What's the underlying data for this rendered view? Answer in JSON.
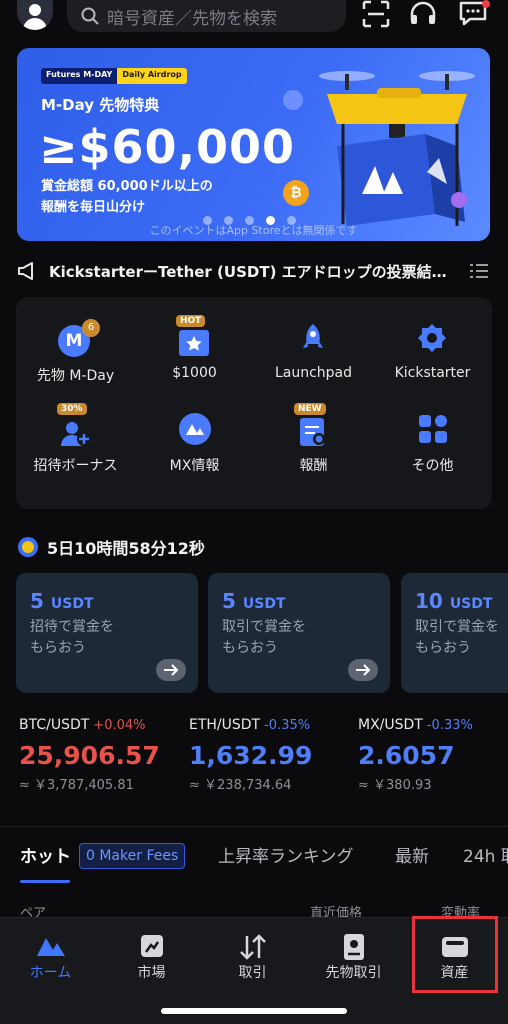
{
  "search": {
    "placeholder": "暗号資産／先物を検索"
  },
  "banner": {
    "tag_left": "Futures M-DAY",
    "tag_right": "Daily Airdrop",
    "subtitle": "M-Day 先物特典",
    "amount": "≥$60,000",
    "desc_line1": "賞金総額 60,000ドル以上の",
    "desc_line2": "報酬を毎日山分け",
    "disclaimer": "このイベントはApp Storeとは無関係です",
    "active_dot": 4,
    "dot_count": 5
  },
  "announcement": {
    "text": "KickstarterーTether (USDT) エアドロップの投票結…"
  },
  "shortcuts": [
    {
      "label": "先物 M-Day",
      "icon": "m-day-icon",
      "badge": "6"
    },
    {
      "label": "$1000",
      "icon": "ticket-icon",
      "badge": "HOT"
    },
    {
      "label": "Launchpad",
      "icon": "rocket-icon",
      "badge": ""
    },
    {
      "label": "Kickstarter",
      "icon": "gear-badge-icon",
      "badge": ""
    },
    {
      "label": "招待ボーナス",
      "icon": "invite-user-icon",
      "badge": "30%"
    },
    {
      "label": "MX情報",
      "icon": "mx-logo-icon",
      "badge": ""
    },
    {
      "label": "報酬",
      "icon": "reward-icon",
      "badge": "NEW"
    },
    {
      "label": "その他",
      "icon": "grid-icon",
      "badge": ""
    }
  ],
  "countdown": {
    "text": "5日10時間58分12秒"
  },
  "rewards": [
    {
      "amount": "5",
      "unit": "USDT",
      "line1": "招待で賞金を",
      "line2": "もらおう"
    },
    {
      "amount": "5",
      "unit": "USDT",
      "line1": "取引で賞金を",
      "line2": "もらおう"
    },
    {
      "amount": "10",
      "unit": "USDT",
      "line1": "取引で賞金を",
      "line2": "もらおう"
    }
  ],
  "tickers": [
    {
      "pair": "BTC/USDT",
      "change": "+0.04%",
      "price": "25,906.57",
      "fiat": "≈ ￥3,787,405.81",
      "color": "#e5534b"
    },
    {
      "pair": "ETH/USDT",
      "change": "-0.35%",
      "price": "1,632.99",
      "fiat": "≈ ￥238,734.64",
      "color": "#4f7ef7"
    },
    {
      "pair": "MX/USDT",
      "change": "-0.33%",
      "price": "2.6057",
      "fiat": "≈ ￥380.93",
      "color": "#4f7ef7"
    }
  ],
  "tabs": {
    "hot": "ホット",
    "fee_badge": "0 Maker Fees",
    "gainers": "上昇率ランキング",
    "newest": "最新",
    "volume": "24h 取"
  },
  "columns": {
    "pair": "ペア",
    "price": "直近価格",
    "change": "変動率"
  },
  "nav": [
    {
      "label": "ホーム",
      "icon": "home-logo-icon"
    },
    {
      "label": "市場",
      "icon": "market-chart-icon"
    },
    {
      "label": "取引",
      "icon": "trade-arrows-icon"
    },
    {
      "label": "先物取引",
      "icon": "futures-doc-icon"
    },
    {
      "label": "資産",
      "icon": "wallet-icon"
    }
  ],
  "colors": {
    "accent": "#3b6df7",
    "up": "#e5534b",
    "down": "#4f7ef7",
    "highlight": "#e8323c"
  }
}
